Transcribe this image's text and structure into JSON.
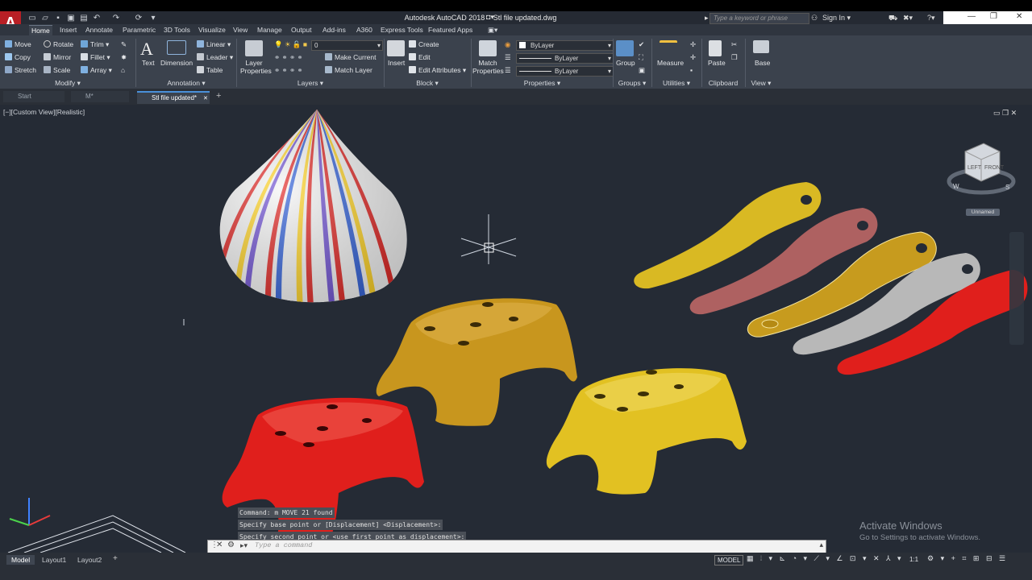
{
  "app": {
    "name": "Autodesk AutoCAD 2018",
    "file": "Stl file updated.dwg",
    "search_placeholder": "Type a keyword or phrase",
    "sign_in": "Sign In"
  },
  "ribbon_tabs": [
    "Home",
    "Insert",
    "Annotate",
    "Parametric",
    "3D Tools",
    "Visualize",
    "View",
    "Manage",
    "Output",
    "Add-ins",
    "A360",
    "Express Tools",
    "Featured Apps"
  ],
  "active_tab": "Home",
  "modify": {
    "col1": [
      "Move",
      "Copy",
      "Stretch"
    ],
    "col2": [
      "Rotate",
      "Mirror",
      "Scale"
    ],
    "col3": [
      "Trim",
      "Fillet",
      "Array"
    ],
    "panel": "Modify"
  },
  "annotation": {
    "text": "Text",
    "dimension": "Dimension",
    "linear": "Linear",
    "leader": "Leader",
    "table": "Table",
    "panel": "Annotation"
  },
  "layers": {
    "layer_properties": "Layer Properties",
    "current_layer": "0",
    "make_current": "Make Current",
    "match_layer": "Match Layer",
    "panel": "Layers"
  },
  "block": {
    "insert": "Insert",
    "create": "Create",
    "edit": "Edit",
    "edit_attributes": "Edit Attributes",
    "panel": "Block"
  },
  "properties": {
    "match_properties": "Match Properties",
    "color": "ByLayer",
    "linetype": "ByLayer",
    "lineweight": "ByLayer",
    "panel": "Properties"
  },
  "groups": {
    "group": "Group",
    "panel": "Groups"
  },
  "utilities": {
    "measure": "Measure",
    "panel": "Utilities"
  },
  "clipboard": {
    "paste": "Paste",
    "panel": "Clipboard"
  },
  "view": {
    "base": "Base",
    "panel": "View"
  },
  "doc_tabs": [
    "Start",
    "M*",
    "Stl file updated*"
  ],
  "active_doc": "Stl file updated*",
  "viewport_label": "[−][Custom View][Realistic]",
  "viewcube": {
    "face_left": "LEFT",
    "face_front": "FRONT",
    "compass_w": "W",
    "compass_s": "S",
    "ucs_name": "Unnamed"
  },
  "command_history": [
    "Command: m MOVE 21 found",
    "Specify base point or [Displacement] <Displacement>:",
    "Specify second point or <use first point as displacement>:"
  ],
  "command_placeholder": "Type a command",
  "watermark": {
    "title": "Activate Windows",
    "subtitle": "Go to Settings to activate Windows."
  },
  "layout_tabs": [
    "Model",
    "Layout1",
    "Layout2"
  ],
  "status": {
    "model": "MODEL",
    "scale": "1:1"
  },
  "colors": {
    "stool_red": "#e01f1c",
    "stool_orange": "#c8961e",
    "stool_yellow": "#e2c122",
    "viewport": "#252b35"
  }
}
